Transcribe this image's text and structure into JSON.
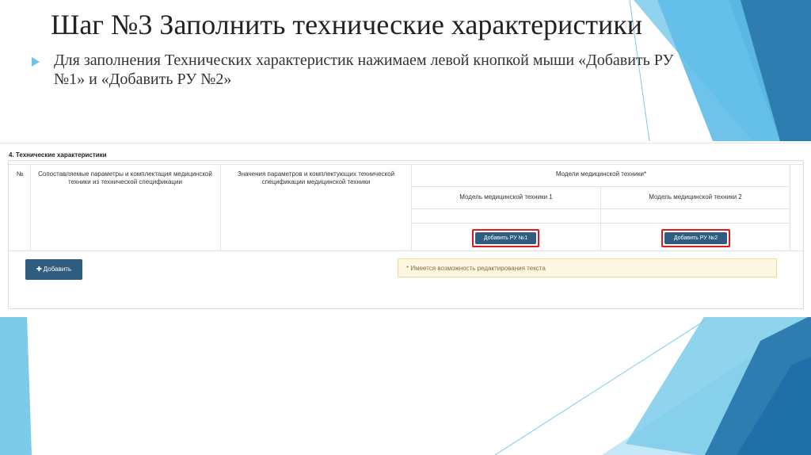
{
  "slide": {
    "title": "Шаг №3 Заполнить технические характеристики",
    "bullet": "Для заполнения Технических характеристик нажимаем левой кнопкой мыши «Добавить РУ №1» и «Добавить РУ №2»"
  },
  "form": {
    "section_title": "4. Технические характеристики",
    "table": {
      "col_num": "№",
      "col_params": "Сопоставляемые параметры и комплектация медицинской техники из технической спецификации",
      "col_values": "Значения параметров и комплектующих технической спецификации медицинской техники",
      "col_models": "Модели медицинской техники*",
      "model_1": "Модель медицинской техники 1",
      "model_2": "Модель медицинской техники 2",
      "btn_ru1": "Добавить РУ №1",
      "btn_ru2": "Добавить РУ №2"
    },
    "add_button": "Добавить",
    "add_icon": "plus-icon",
    "notice": "* Имеется возможность редактирования текста"
  },
  "colors": {
    "button": "#2e5d7f",
    "highlight": "#e01818",
    "accent_blue": "#6cc5e8",
    "notice_bg": "#fcf8e3"
  }
}
